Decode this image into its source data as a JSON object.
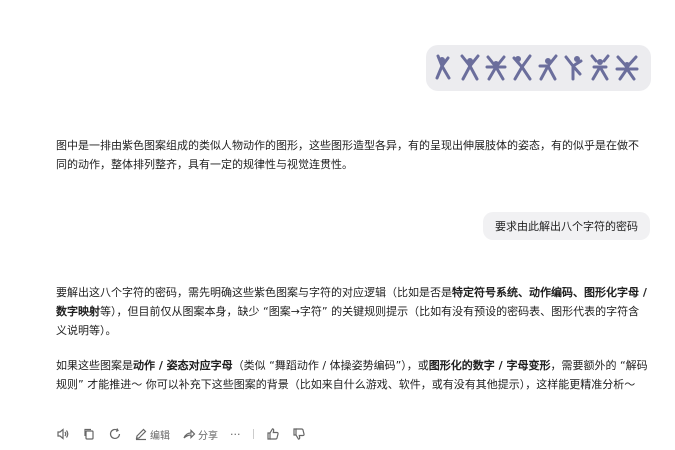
{
  "user_image": {
    "figure_count": 8,
    "figure_color": "#6b6e9c"
  },
  "answer1": {
    "text": "图中是一排由紫色图案组成的类似人物动作的图形，这些图形造型各异，有的呈现出伸展肢体的姿态，有的似乎是在做不同的动作，整体排列整齐，具有一定的规律性与视觉连贯性。"
  },
  "user_message": {
    "text": "要求由此解出八个字符的密码"
  },
  "answer2": {
    "p1_a": "要解出这八个字符的密码，需先明确这些紫色图案与字符的对应逻辑（比如是否是",
    "p1_b1": "特定符号系统、动作编码、图形化字母 / 数字映射",
    "p1_c": "等），但目前仅从图案本身，缺少 “图案→字符” 的关键规则提示（比如有没有预设的密码表、图形代表的字符含义说明等）。",
    "p2_a": "如果这些图案是",
    "p2_b1": "动作 / 姿态对应字母",
    "p2_c": "（类似 “舞蹈动作 / 体操姿势编码”），或",
    "p2_b2": "图形化的数字 / 字母变形",
    "p2_d": "，需要额外的 “解码规则” 才能推进～ 你可以补充下这些图案的背景（比如来自什么游戏、软件，或有没有其他提示），这样能更精准分析～"
  },
  "toolbar": {
    "edit_label": "编辑",
    "share_label": "分享",
    "more_label": "···"
  }
}
